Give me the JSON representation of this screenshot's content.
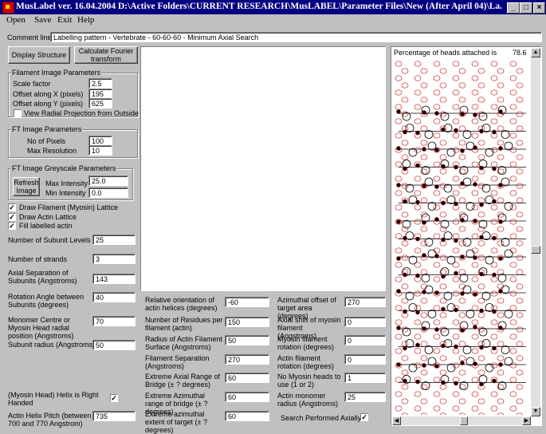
{
  "window": {
    "title": "MusLabel ver. 16.04.2004  D:\\Active Folders\\CURRENT RESEARCH\\MusLABEL\\Parameter Files\\New (After April 04)\\La..."
  },
  "menu": [
    "Open",
    "Save",
    "Exit",
    "Help"
  ],
  "comment": {
    "label": "Comment line:",
    "value": "Labelling pattern - Vertebrate - 60-60-60 - Minimum Axial Search"
  },
  "buttons": {
    "display_structure": "Display Structure",
    "calc_fourier_1": "Calculate   Fourier",
    "calc_fourier_2": "transform",
    "refresh_1": "Refresh",
    "refresh_2": "Image"
  },
  "filament_params": {
    "title": "Filament Image Parameters",
    "scale_label": "Scale factor",
    "scale_value": "2.5",
    "offx_label": "Offset along X (pixels)",
    "offx_value": "195",
    "offy_label": "Offset along Y (pixels)",
    "offy_value": "625",
    "radial_label": "View Radial Projection from Outside"
  },
  "ft_params": {
    "title": "FT Image Parameters",
    "pixels_label": "No of Pixels",
    "pixels_value": "100",
    "maxres_label": "Max Resolution",
    "maxres_value": "10"
  },
  "greyscale": {
    "title": "FT Image Greyscale Parameters",
    "maxint_label": "Max Intensity",
    "maxint_value": "25.0",
    "minint_label": "Min Intensity",
    "minint_value": "0.0"
  },
  "checks": {
    "draw_filament": "Draw Filament (Myosin) Lattice",
    "draw_actin": "Draw Actin Lattice",
    "fill_labelled": "Fill labelled actin",
    "checkmark": "✓"
  },
  "left_params": {
    "subunit_levels_label": "Number of Subunit Levels",
    "subunit_levels_value": "25",
    "strands_label": "Number of strands",
    "strands_value": "3",
    "axial_sep_label": "Axial Separation of Subunits (Angstroms)",
    "axial_sep_value": "143",
    "rotation_label": "Rotation Angle between Subunits (degrees)",
    "rotation_value": "40",
    "monomer_label": "Monomer Centre or Myosin Head radial position (Angstroms)",
    "monomer_value": "70",
    "radius_label": "Subunit radius (Angstroms)",
    "radius_value": "50",
    "helix_label": "(Myosin Head) Helix is Right Handed",
    "pitch_label": "Actin Helix Pitch (between 700 and 770 Angstrom)",
    "pitch_value": "735"
  },
  "mid_params": {
    "rel_orient_label": "Relative orientation of actin helices (degrees)",
    "rel_orient_value": "-60",
    "residues_label": "Number of Residues per filament (actin)",
    "residues_value": "150",
    "radius_actin_label": "Radius of Actin Filament Surface (Angstroms)",
    "radius_actin_value": "50",
    "filament_sep_label": "Filament Separation (Angstroms)",
    "filament_sep_value": "270",
    "ext_axial_label": "Extreme Axial Range of Bridge (± ? degrees)",
    "ext_axial_value": "60",
    "ext_azim_label": "Extreme Azimuthal range of bridge (± ? degrees)",
    "ext_azim_value": "60",
    "ext_target_label": "Extreme azimuthal extent of target (± ? degrees)",
    "ext_target_value": "60"
  },
  "right_params": {
    "azim_offset_label": "Azimuthal offset of target area (degrees)",
    "azim_offset_value": "270",
    "axial_shift_label": "Axial shift of myosin filament (Angstroms)",
    "axial_shift_value": "0",
    "myosin_rot_label": "Myosin filament rotation (degrees)",
    "myosin_rot_value": "0",
    "actin_rot_label": "Actin filament rotation (degrees)",
    "actin_rot_value": "0",
    "no_heads_label": "No Myosin heads to use (1 or 2)",
    "no_heads_value": "1",
    "monomer_radius_label": "Actin monomer radius (Angstroms)",
    "monomer_radius_value": "25",
    "search_axially_label": "Search Performed Axially"
  },
  "lattice": {
    "heads_label": "Percentage of heads attached is",
    "heads_value": "78.6",
    "actin_color": "#cc2222",
    "myosin_color": "#000000",
    "actin_columns": 7,
    "helix_rows": 24,
    "myosin_rows": 16
  }
}
